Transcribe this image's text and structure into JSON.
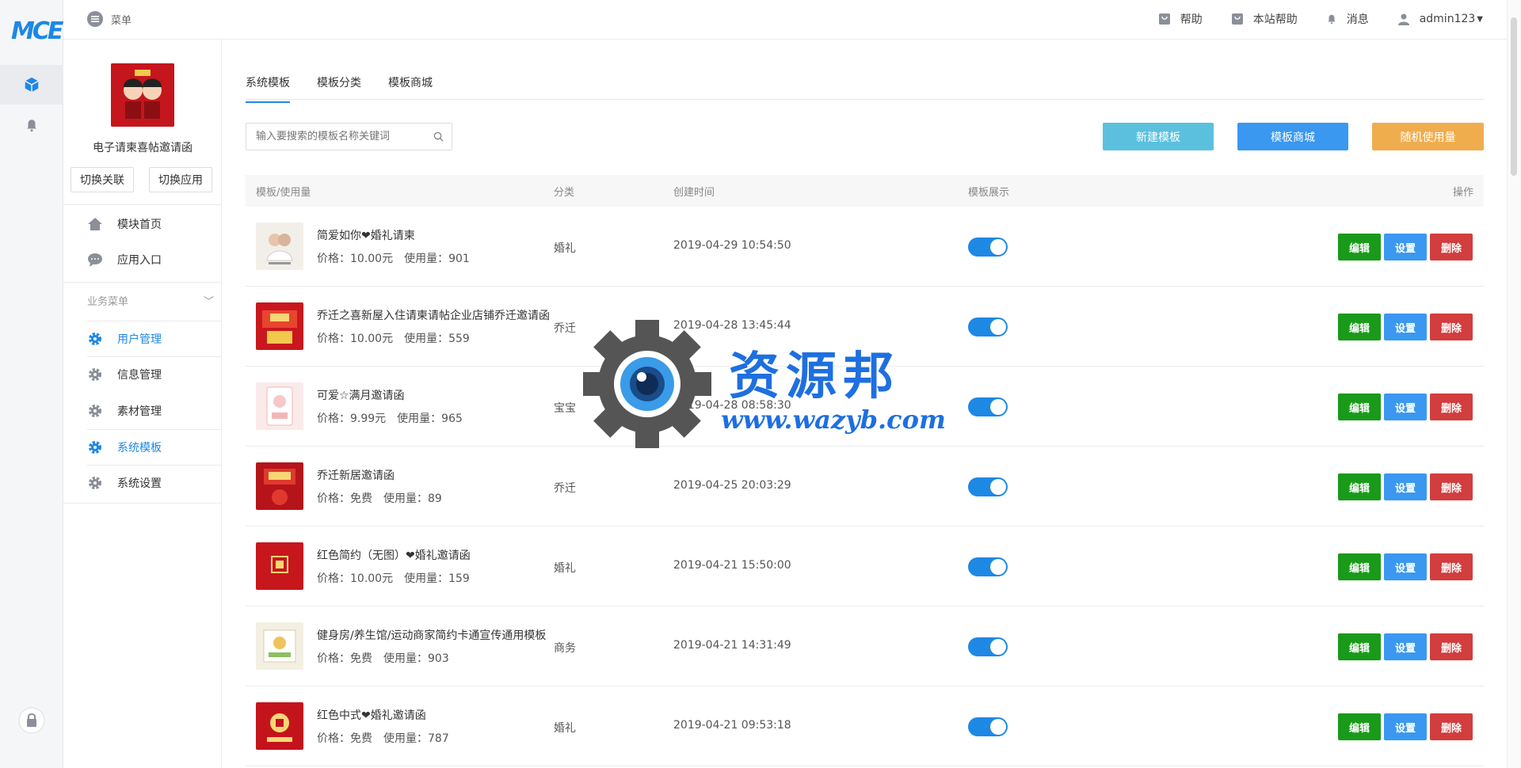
{
  "rail": {
    "logo": "MCE",
    "icons": [
      "cube-icon",
      "bell-icon",
      "lock-icon"
    ]
  },
  "header": {
    "menu_label": "菜单",
    "help_label": "帮助",
    "site_help_label": "本站帮助",
    "messages_label": "消息",
    "user": "admin123"
  },
  "sidebar": {
    "app_name": "电子请柬喜帖邀请函",
    "switch_link_label": "切换关联",
    "switch_app_label": "切换应用",
    "items": [
      {
        "label": "模块首页",
        "icon": "home-icon"
      },
      {
        "label": "应用入口",
        "icon": "chat-icon"
      }
    ],
    "section_label": "业务菜单",
    "business_items": [
      {
        "label": "用户管理",
        "active": true
      },
      {
        "label": "信息管理",
        "active": false
      },
      {
        "label": "素材管理",
        "active": false
      },
      {
        "label": "系统模板",
        "active": true
      },
      {
        "label": "系统设置",
        "active": false
      }
    ]
  },
  "tabs": [
    {
      "label": "系统模板",
      "active": true
    },
    {
      "label": "模板分类",
      "active": false
    },
    {
      "label": "模板商城",
      "active": false
    }
  ],
  "search": {
    "placeholder": "输入要搜索的模板名称关键词"
  },
  "actions": {
    "new_label": "新建模板",
    "mall_label": "模板商城",
    "random_label": "随机使用量",
    "colors": {
      "new": "#5bc0de",
      "mall": "#3a98f0",
      "random": "#f0ad4e"
    }
  },
  "table": {
    "headers": {
      "template": "模板/使用量",
      "category": "分类",
      "created": "创建时间",
      "display": "模板展示",
      "ops": "操作"
    },
    "price_label": "价格：",
    "usage_label": "使用量：",
    "op_labels": {
      "edit": "编辑",
      "settings": "设置",
      "delete": "删除"
    },
    "rows": [
      {
        "name": "简爱如你❤婚礼请柬",
        "price": "10.00元",
        "usage": "901",
        "category": "婚礼",
        "created": "2019-04-29 10:54:50",
        "display_on": true
      },
      {
        "name": "乔迁之喜新屋入住请柬请帖企业店铺乔迁邀请函",
        "price": "10.00元",
        "usage": "559",
        "category": "乔迁",
        "created": "2019-04-28 13:45:44",
        "display_on": true
      },
      {
        "name": "可爱☆满月邀请函",
        "price": "9.99元",
        "usage": "965",
        "category": "宝宝",
        "created": "2019-04-28 08:58:30",
        "display_on": true
      },
      {
        "name": "乔迁新居邀请函",
        "price": "免费",
        "usage": "89",
        "category": "乔迁",
        "created": "2019-04-25 20:03:29",
        "display_on": true
      },
      {
        "name": "红色简约（无图）❤婚礼邀请函",
        "price": "10.00元",
        "usage": "159",
        "category": "婚礼",
        "created": "2019-04-21 15:50:00",
        "display_on": true
      },
      {
        "name": "健身房/养生馆/运动商家简约卡通宣传通用模板",
        "price": "免费",
        "usage": "903",
        "category": "商务",
        "created": "2019-04-21 14:31:49",
        "display_on": true
      },
      {
        "name": "红色中式❤婚礼邀请函",
        "price": "免费",
        "usage": "787",
        "category": "婚礼",
        "created": "2019-04-21 09:53:18",
        "display_on": true
      }
    ]
  },
  "watermark": {
    "title": "资源邦",
    "url": "www.wazyb.com"
  }
}
